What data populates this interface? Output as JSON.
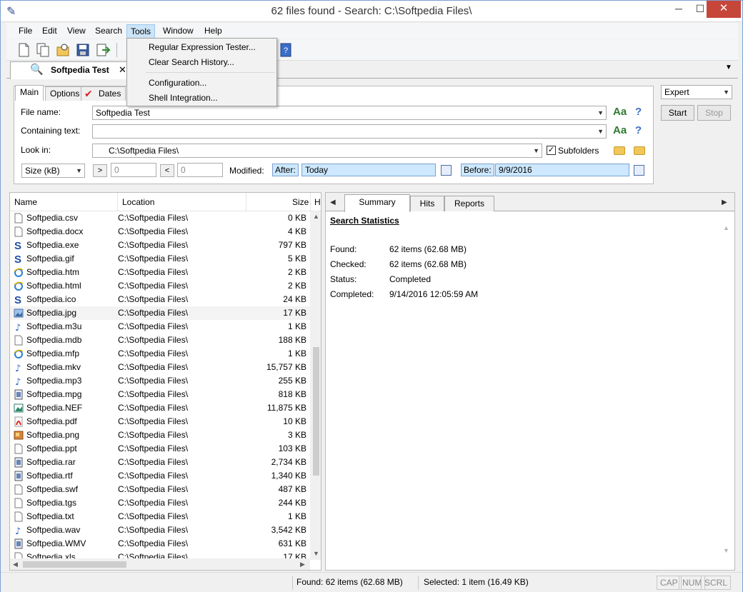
{
  "window": {
    "title": "62 files found - Search: C:\\Softpedia Files\\",
    "min": "─",
    "max": "☐",
    "close": "✕"
  },
  "menubar": {
    "items": [
      {
        "label": "File"
      },
      {
        "label": "Edit"
      },
      {
        "label": "View"
      },
      {
        "label": "Search"
      },
      {
        "label": "Tools"
      },
      {
        "label": "Window"
      },
      {
        "label": "Help"
      }
    ]
  },
  "tools_menu": {
    "items": [
      {
        "label": "Regular Expression Tester..."
      },
      {
        "label": "Clear Search History..."
      },
      {
        "label": "Configuration..."
      },
      {
        "label": "Shell Integration..."
      }
    ]
  },
  "doc_tab": {
    "label": "Softpedia Test",
    "close": "✕"
  },
  "search_tabs": [
    {
      "label": "Main"
    },
    {
      "label": "Options"
    },
    {
      "label": "Dates"
    }
  ],
  "form": {
    "file_name_label": "File name:",
    "file_name_value": "Softpedia Test",
    "containing_text_label": "Containing text:",
    "containing_text_value": "",
    "look_in_label": "Look in:",
    "look_in_value": "C:\\Softpedia Files\\",
    "subfolders_label": "Subfolders",
    "subfolders_checked": true,
    "case_label": "Aa",
    "help_label": "?",
    "size_unit": "Size (kB)",
    "gt_label": ">",
    "gt_value": "0",
    "lt_label": "<",
    "lt_value": "0",
    "modified_label": "Modified:",
    "after_label": "After:",
    "after_value": "Today",
    "before_label": "Before:",
    "before_value": "9/9/2016"
  },
  "side": {
    "mode": "Expert",
    "start": "Start",
    "stop": "Stop"
  },
  "results": {
    "columns": [
      "Name",
      "Location",
      "Size",
      "H"
    ],
    "rows": [
      {
        "name": "Softpedia.csv",
        "loc": "C:\\Softpedia Files\\",
        "size": "0 KB",
        "icon": "doc"
      },
      {
        "name": "Softpedia.docx",
        "loc": "C:\\Softpedia Files\\",
        "size": "4 KB",
        "icon": "doc"
      },
      {
        "name": "Softpedia.exe",
        "loc": "C:\\Softpedia Files\\",
        "size": "797 KB",
        "icon": "s"
      },
      {
        "name": "Softpedia.gif",
        "loc": "C:\\Softpedia Files\\",
        "size": "5 KB",
        "icon": "s"
      },
      {
        "name": "Softpedia.htm",
        "loc": "C:\\Softpedia Files\\",
        "size": "2 KB",
        "icon": "ie"
      },
      {
        "name": "Softpedia.html",
        "loc": "C:\\Softpedia Files\\",
        "size": "2 KB",
        "icon": "ie"
      },
      {
        "name": "Softpedia.ico",
        "loc": "C:\\Softpedia Files\\",
        "size": "24 KB",
        "icon": "s"
      },
      {
        "name": "Softpedia.jpg",
        "loc": "C:\\Softpedia Files\\",
        "size": "17 KB",
        "icon": "img"
      },
      {
        "name": "Softpedia.m3u",
        "loc": "C:\\Softpedia Files\\",
        "size": "1 KB",
        "icon": "music"
      },
      {
        "name": "Softpedia.mdb",
        "loc": "C:\\Softpedia Files\\",
        "size": "188 KB",
        "icon": "doc"
      },
      {
        "name": "Softpedia.mfp",
        "loc": "C:\\Softpedia Files\\",
        "size": "1 KB",
        "icon": "ie"
      },
      {
        "name": "Softpedia.mkv",
        "loc": "C:\\Softpedia Files\\",
        "size": "15,757 KB",
        "icon": "music"
      },
      {
        "name": "Softpedia.mp3",
        "loc": "C:\\Softpedia Files\\",
        "size": "255 KB",
        "icon": "music"
      },
      {
        "name": "Softpedia.mpg",
        "loc": "C:\\Softpedia Files\\",
        "size": "818 KB",
        "icon": "film"
      },
      {
        "name": "Softpedia.NEF",
        "loc": "C:\\Softpedia Files\\",
        "size": "11,875 KB",
        "icon": "photo"
      },
      {
        "name": "Softpedia.pdf",
        "loc": "C:\\Softpedia Files\\",
        "size": "10 KB",
        "icon": "pdf"
      },
      {
        "name": "Softpedia.png",
        "loc": "C:\\Softpedia Files\\",
        "size": "3 KB",
        "icon": "png"
      },
      {
        "name": "Softpedia.ppt",
        "loc": "C:\\Softpedia Files\\",
        "size": "103 KB",
        "icon": "doc"
      },
      {
        "name": "Softpedia.rar",
        "loc": "C:\\Softpedia Files\\",
        "size": "2,734 KB",
        "icon": "film"
      },
      {
        "name": "Softpedia.rtf",
        "loc": "C:\\Softpedia Files\\",
        "size": "1,340 KB",
        "icon": "film"
      },
      {
        "name": "Softpedia.swf",
        "loc": "C:\\Softpedia Files\\",
        "size": "487 KB",
        "icon": "doc"
      },
      {
        "name": "Softpedia.tgs",
        "loc": "C:\\Softpedia Files\\",
        "size": "244 KB",
        "icon": "doc"
      },
      {
        "name": "Softpedia.txt",
        "loc": "C:\\Softpedia Files\\",
        "size": "1 KB",
        "icon": "doc"
      },
      {
        "name": "Softpedia.wav",
        "loc": "C:\\Softpedia Files\\",
        "size": "3,542 KB",
        "icon": "music"
      },
      {
        "name": "Softpedia.WMV",
        "loc": "C:\\Softpedia Files\\",
        "size": "631 KB",
        "icon": "film"
      },
      {
        "name": "Softpedia.xls",
        "loc": "C:\\Softpedia Files\\",
        "size": "17 KB",
        "icon": "doc"
      }
    ],
    "selected_index": 7
  },
  "details": {
    "tabs": [
      {
        "label": "Summary"
      },
      {
        "label": "Hits"
      },
      {
        "label": "Reports"
      }
    ],
    "title": "Search Statistics",
    "stats": [
      {
        "label": "Found:",
        "value": "62 items (62.68 MB)"
      },
      {
        "label": "Checked:",
        "value": "62 items (62.68 MB)"
      },
      {
        "label": "Status:",
        "value": "Completed"
      },
      {
        "label": "Completed:",
        "value": "9/14/2016 12:05:59 AM"
      }
    ]
  },
  "statusbar": {
    "found": "Found: 62 items (62.68 MB)",
    "selected": "Selected: 1 item (16.49 KB)",
    "keys": [
      "CAP",
      "NUM",
      "SCRL"
    ]
  },
  "colors": {
    "accent": "#cce4f7",
    "date_bg": "#cde8ff",
    "close": "#c7463a",
    "case_green": "#2f7a2f",
    "help_blue": "#3a6fc9"
  }
}
